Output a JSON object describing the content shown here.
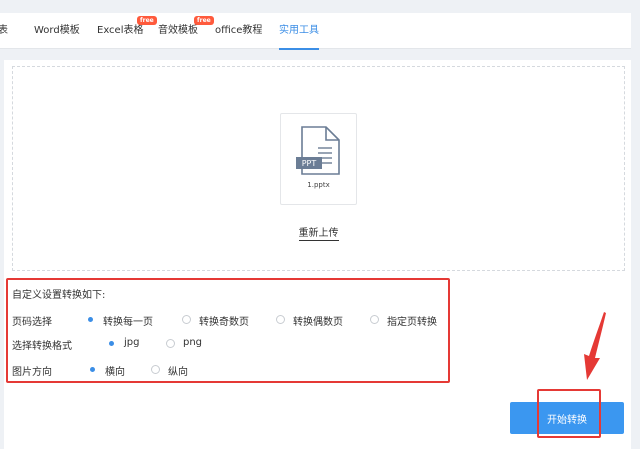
{
  "nav": {
    "tabs": [
      {
        "label": "图表",
        "active": false,
        "free": false
      },
      {
        "label": "Word模板",
        "active": false,
        "free": false
      },
      {
        "label": "Excel表格",
        "active": false,
        "free": true
      },
      {
        "label": "音效模板",
        "active": false,
        "free": true
      },
      {
        "label": "office教程",
        "active": false,
        "free": false
      },
      {
        "label": "实用工具",
        "active": true,
        "free": false
      }
    ],
    "free_badge": "free"
  },
  "upload": {
    "file_type": "PPT",
    "file_name": "1.pptx",
    "reupload_label": "重新上传"
  },
  "settings": {
    "title": "自定义设置转换如下:",
    "page_select": {
      "label": "页码选择",
      "options": [
        "转换每一页",
        "转换奇数页",
        "转换偶数页",
        "指定页转换"
      ],
      "selected": 0
    },
    "format_select": {
      "label": "选择转换格式",
      "options": [
        "jpg",
        "png"
      ],
      "selected": 0
    },
    "orientation": {
      "label": "图片方向",
      "options": [
        "横向",
        "纵向"
      ],
      "selected": 0
    }
  },
  "start_button": {
    "label": "开始转换"
  },
  "colors": {
    "accent": "#3b8ee6",
    "highlight": "#e53935",
    "badge": "#ff5a3c"
  }
}
